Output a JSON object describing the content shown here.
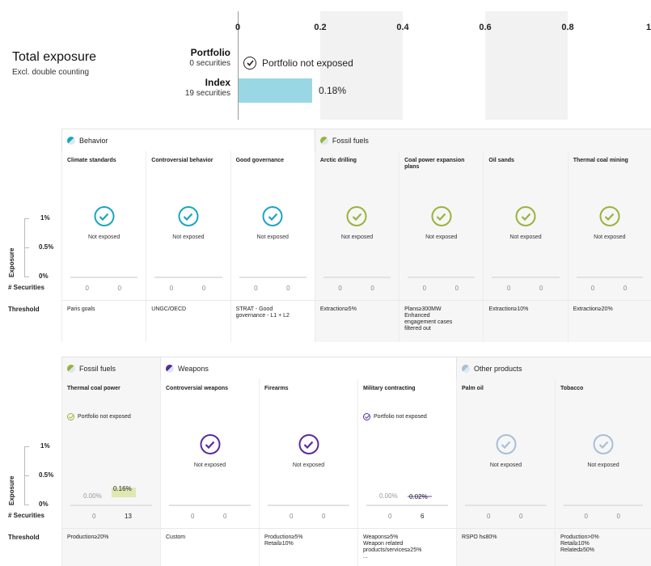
{
  "axis": {
    "ticks": [
      "0",
      "0.2",
      "0.4",
      "0.6",
      "0.8",
      "1"
    ]
  },
  "total": {
    "title": "Total exposure",
    "subtitle": "Excl. double counting",
    "portfolio": {
      "name": "Portfolio",
      "count": "0 securities",
      "status": "Portfolio not exposed"
    },
    "index": {
      "name": "Index",
      "count": "19 securities",
      "value": "0.18%",
      "value_num": 0.18
    }
  },
  "labels": {
    "exposure": "Exposure",
    "securities": "# Securities",
    "threshold": "Threshold",
    "y_1": "1%",
    "y_05": "0.5%",
    "y_0": "0%",
    "not_exposed": "Not exposed",
    "portfolio_not_exposed": "Portfolio not exposed"
  },
  "colors": {
    "teal": "#1aa6bf",
    "olive": "#9ab23c",
    "purple": "#5a2a9e",
    "grey": "#a9bfd6",
    "index_bar": "#9ad7e4",
    "olive_bar": "#dfe8b2",
    "purple_bar": "#b9a0dd"
  },
  "section1": {
    "groups": [
      {
        "label": "Behavior",
        "color": "#1aa6bf",
        "span": 3,
        "shade": false
      },
      {
        "label": "Fossil fuels",
        "color": "#9ab23c",
        "span": 4,
        "shade": true
      }
    ],
    "columns": [
      {
        "title": "Climate standards",
        "p": "0",
        "i": "0",
        "threshold": "Paris goals",
        "color": "#1aa6bf",
        "shade": false
      },
      {
        "title": "Controversial behavior",
        "p": "0",
        "i": "0",
        "threshold": "UNGC/OECD",
        "color": "#1aa6bf",
        "shade": false
      },
      {
        "title": "Good governance",
        "p": "0",
        "i": "0",
        "threshold": "STRAT - Good\ngovernance - L1 + L2",
        "color": "#1aa6bf",
        "shade": false
      },
      {
        "title": "Arctic drilling",
        "p": "0",
        "i": "0",
        "threshold": "Extraction≥5%",
        "color": "#9ab23c",
        "shade": true
      },
      {
        "title": "Coal power expansion plans",
        "p": "0",
        "i": "0",
        "threshold": "Plans≥300MW\nEnhanced\nengagement cases\nfiltered out",
        "color": "#9ab23c",
        "shade": true
      },
      {
        "title": "Oil sands",
        "p": "0",
        "i": "0",
        "threshold": "Extraction≥10%",
        "color": "#9ab23c",
        "shade": true
      },
      {
        "title": "Thermal coal mining",
        "p": "0",
        "i": "0",
        "threshold": "Extraction≥20%",
        "color": "#9ab23c",
        "shade": true
      }
    ]
  },
  "section2": {
    "groups": [
      {
        "label": "Fossil fuels",
        "color": "#9ab23c",
        "span": 1,
        "shade": true
      },
      {
        "label": "Weapons",
        "color": "#5a2a9e",
        "span": 3,
        "shade": false
      },
      {
        "label": "Other products",
        "color": "#a9bfd6",
        "span": 2,
        "shade": true
      }
    ],
    "columns": [
      {
        "title": "Thermal coal power",
        "p": "0",
        "i": "13",
        "threshold": "Production≥20%",
        "color": "#9ab23c",
        "shade": true,
        "exposed": true,
        "p_pct": "0.00%",
        "i_pct": "0.16%",
        "i_val": 0.16,
        "bar_color": "#dfe8b2"
      },
      {
        "title": "Controversial weapons",
        "p": "0",
        "i": "0",
        "threshold": "Custom",
        "color": "#5a2a9e",
        "shade": false
      },
      {
        "title": "Firearms",
        "p": "0",
        "i": "0",
        "threshold": "Production≥5%\nRetail≥10%",
        "color": "#5a2a9e",
        "shade": false
      },
      {
        "title": "Military contracting",
        "p": "0",
        "i": "6",
        "threshold": "Weapons≥5%\nWeapon related\nproducts/services≥25%\n...",
        "color": "#5a2a9e",
        "shade": false,
        "exposed": true,
        "p_pct": "0.00%",
        "i_pct": "0.02%",
        "i_val": 0.02,
        "bar_color": "#b9a0dd"
      },
      {
        "title": "Palm oil",
        "p": "0",
        "i": "0",
        "threshold": "RSPO h≤80%",
        "color": "#a9bfd6",
        "shade": true
      },
      {
        "title": "Tobacco",
        "p": "0",
        "i": "0",
        "threshold": "Production>0%\nRetail≥10%\nRelated≥50%",
        "color": "#a9bfd6",
        "shade": true
      }
    ]
  }
}
